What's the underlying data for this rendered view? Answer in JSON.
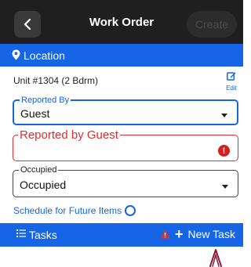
{
  "header": {
    "title": "Work Order",
    "create_label": "Create"
  },
  "location": {
    "label": "Location"
  },
  "unit": {
    "text": "Unit #1304 (2 Bdrm)",
    "edit_label": "Edit"
  },
  "reported_by": {
    "legend": "Reported By",
    "value": "Guest"
  },
  "reported_by_guest": {
    "legend": "Reported by Guest",
    "value": ""
  },
  "occupied": {
    "legend": "Occupied",
    "value": "Occupied"
  },
  "schedule": {
    "label": "Schedule for Future Items"
  },
  "tasks": {
    "label": "Tasks",
    "new_task_label": "New Task"
  },
  "colors": {
    "accent": "#1565e6",
    "header_bg": "#1f1f1f",
    "error": "#d93030"
  },
  "icons": [
    "back-icon",
    "location-pin-icon",
    "edit-icon",
    "chevron-down-icon",
    "error-icon",
    "radio-icon",
    "list-icon",
    "warning-icon",
    "plus-icon"
  ]
}
